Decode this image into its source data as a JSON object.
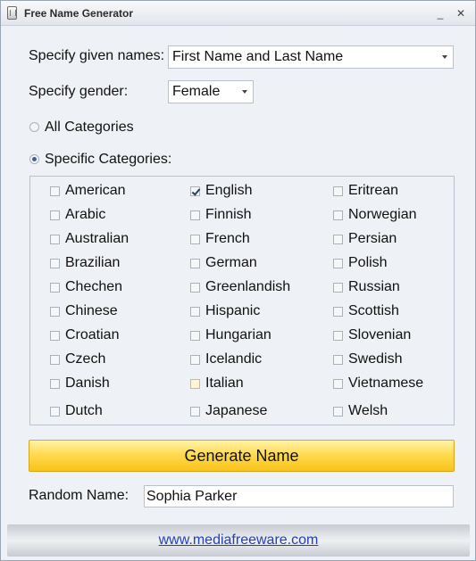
{
  "window": {
    "title": "Free Name Generator",
    "minimize": "_",
    "close": "✕"
  },
  "given_names": {
    "label": "Specify given names:",
    "value": "First Name and Last Name"
  },
  "gender": {
    "label": "Specify gender:",
    "value": "Female"
  },
  "category_mode": {
    "all_label": "All Categories",
    "specific_label": "Specific Categories:",
    "selected": "specific"
  },
  "categories": [
    {
      "label": "American",
      "checked": false
    },
    {
      "label": "Arabic",
      "checked": false
    },
    {
      "label": "Australian",
      "checked": false
    },
    {
      "label": "Brazilian",
      "checked": false
    },
    {
      "label": "Chechen",
      "checked": false
    },
    {
      "label": "Chinese",
      "checked": false
    },
    {
      "label": "Croatian",
      "checked": false
    },
    {
      "label": "Czech",
      "checked": false
    },
    {
      "label": "Danish",
      "checked": false
    },
    {
      "label": "Dutch",
      "checked": false
    },
    {
      "label": "English",
      "checked": true
    },
    {
      "label": "Finnish",
      "checked": false
    },
    {
      "label": "French",
      "checked": false
    },
    {
      "label": "German",
      "checked": false
    },
    {
      "label": "Greenlandish",
      "checked": false
    },
    {
      "label": "Hispanic",
      "checked": false
    },
    {
      "label": "Hungarian",
      "checked": false
    },
    {
      "label": "Icelandic",
      "checked": false
    },
    {
      "label": "Italian",
      "checked": false
    },
    {
      "label": "Japanese",
      "checked": false
    },
    {
      "label": "Eritrean",
      "checked": false
    },
    {
      "label": "Norwegian",
      "checked": false
    },
    {
      "label": "Persian",
      "checked": false
    },
    {
      "label": "Polish",
      "checked": false
    },
    {
      "label": "Russian",
      "checked": false
    },
    {
      "label": "Scottish",
      "checked": false
    },
    {
      "label": "Slovenian",
      "checked": false
    },
    {
      "label": "Swedish",
      "checked": false
    },
    {
      "label": "Vietnamese",
      "checked": false
    },
    {
      "label": "Welsh",
      "checked": false
    }
  ],
  "generate_button": {
    "label": "Generate Name"
  },
  "random_name": {
    "label": "Random Name:",
    "value": "Sophia Parker"
  },
  "footer": {
    "link": "www.mediafreeware.com"
  },
  "colors": {
    "accent": "#ffd84a",
    "link": "#2040c0"
  }
}
